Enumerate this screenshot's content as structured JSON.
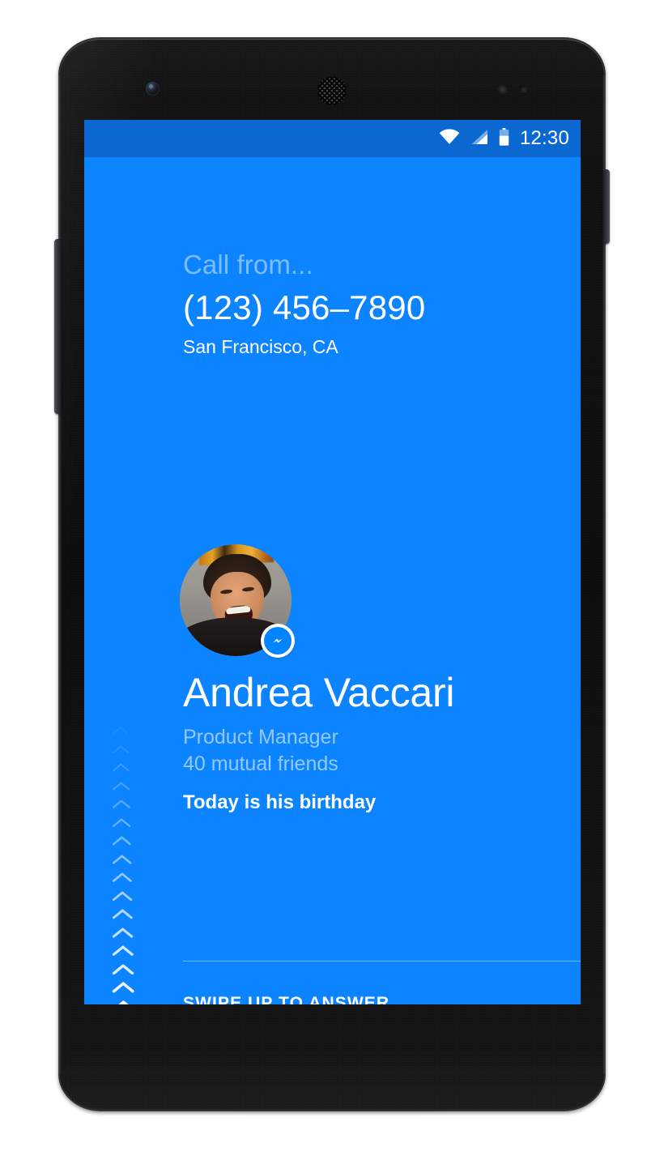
{
  "device": {
    "name": "android-smartphone",
    "front_camera": "front-camera-icon",
    "earpiece": "earpiece-speaker-icon",
    "proximity_sensor": "proximity-sensor-icon",
    "light_sensor": "light-sensor-icon",
    "volume_rocker": "volume-rocker-button",
    "power_button": "power-button"
  },
  "colors": {
    "screen_background": "#0d84ff",
    "status_bar_background": "#0a68d0",
    "messenger_blue": "#0084ff",
    "text_primary": "#ffffff",
    "text_muted": "rgba(255,255,255,0.56)",
    "text_faint": "rgba(255,255,255,0.46)",
    "divider": "rgba(255,255,255,0.42)"
  },
  "status_bar": {
    "time": "12:30",
    "icons": [
      "wifi-icon",
      "cell-signal-icon",
      "battery-icon"
    ],
    "battery_level_percent": 60
  },
  "call": {
    "from_label": "Call from...",
    "number": "(123) 456–7890",
    "location": "San Francisco, CA"
  },
  "contact": {
    "avatar": "contact-avatar-photo",
    "badge": "messenger-badge-icon",
    "name": "Andrea Vaccari",
    "title": "Product Manager",
    "mutual_friends": "40 mutual friends",
    "birthday_note": "Today is his birthday"
  },
  "footer": {
    "swipe_label": "SWIPE UP TO ANSWER",
    "chevron_icon": "chevron-up-icon",
    "chevron_count": 16
  }
}
